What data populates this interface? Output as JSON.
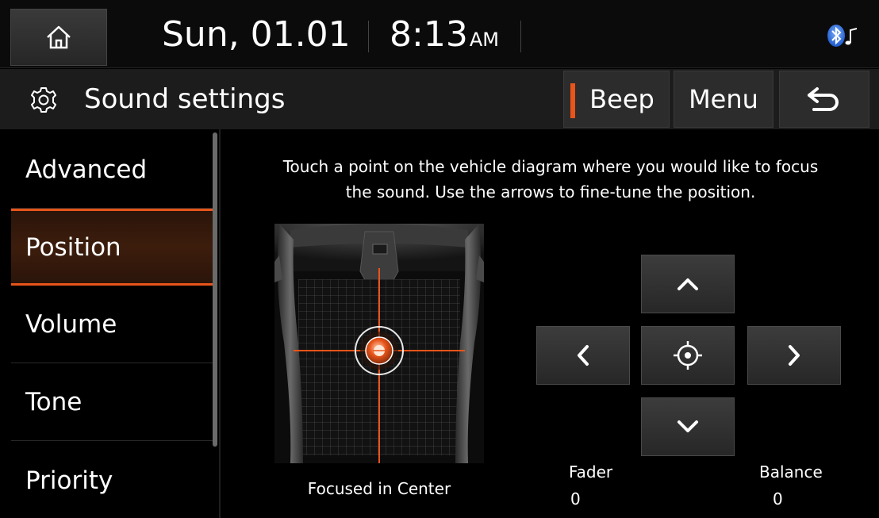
{
  "status_bar": {
    "home_icon": "home-icon",
    "date": "Sun, 01.01",
    "time": "8:13",
    "ampm": "AM",
    "bluetooth_icon": "bluetooth-music-icon"
  },
  "title_bar": {
    "icon": "gear-icon",
    "title": "Sound settings",
    "beep_label": "Beep",
    "beep_indicator_color": "#e8541a",
    "menu_label": "Menu",
    "back_icon": "back-arrow-icon"
  },
  "sidebar": {
    "items": [
      {
        "label": "Advanced",
        "active": false
      },
      {
        "label": "Position",
        "active": true
      },
      {
        "label": "Volume",
        "active": false
      },
      {
        "label": "Tone",
        "active": false
      },
      {
        "label": "Priority",
        "active": false
      }
    ]
  },
  "main": {
    "instruction_line1": "Touch a point on the vehicle diagram where you would like to focus",
    "instruction_line2": "the sound. Use the arrows to fine-tune the position.",
    "focus_status": "Focused in Center",
    "fader_label": "Fader",
    "fader_value": "0",
    "balance_label": "Balance",
    "balance_value": "0",
    "arrow_icons": [
      "chevron-up-icon",
      "chevron-left-icon",
      "crosshair-icon",
      "chevron-right-icon",
      "chevron-down-icon"
    ]
  },
  "colors": {
    "accent": "#e8541a",
    "background": "#000000",
    "button": "#2c2c2c"
  }
}
